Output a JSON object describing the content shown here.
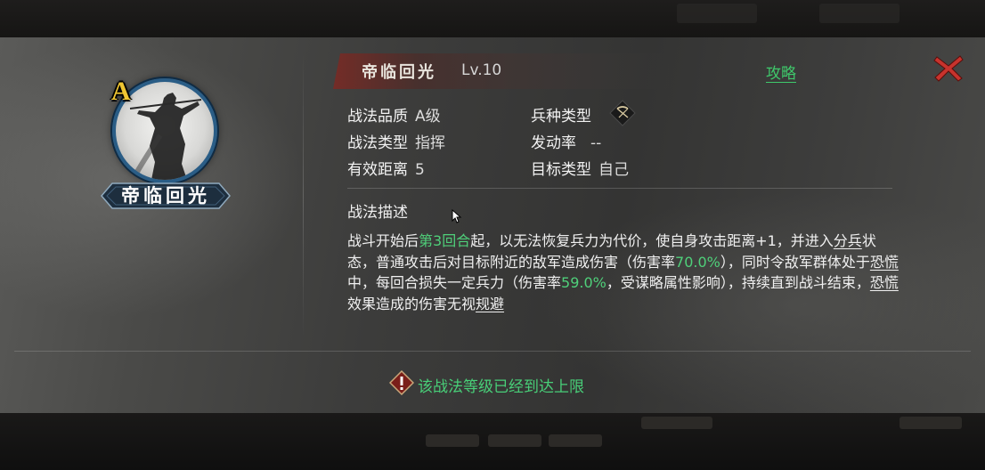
{
  "skill": {
    "name": "帝临回光",
    "level": "Lv.10",
    "grade_badge": "A",
    "plate_name": "帝临回光"
  },
  "header": {
    "guide_label": "攻略"
  },
  "attributes": {
    "quality_label": "战法品质",
    "quality_value": "A级",
    "type_label": "战法类型",
    "type_value": "指挥",
    "range_label": "有效距离",
    "range_value": "5",
    "troop_label": "兵种类型",
    "troop_icon": "bow-icon",
    "rate_label": "发动率",
    "rate_value": "--",
    "target_label": "目标类型",
    "target_value": "自己"
  },
  "description": {
    "title": "战法描述",
    "p1": "战斗开始后",
    "p2": "第3回合",
    "p3": "起，以无法恢复兵力为代价，使自身攻击距离+1，并进入",
    "p4": "分兵",
    "p5": "状态，普通攻击后对目标附近的敌军造成伤害（伤害率",
    "p6": "70.0%",
    "p7": "），同时令敌军群体处于",
    "p8": "恐慌",
    "p9": "中，每回合损失一定兵力（伤害率",
    "p10": "59.0%",
    "p11": "，受谋略属性影响），持续直到战斗结束，",
    "p12": "恐慌",
    "p13": "效果造成的伤害无视",
    "p14": "规避"
  },
  "notice": {
    "text": "该战法等级已经到达上限",
    "icon": "warning-icon"
  },
  "colors": {
    "accent_green": "#3fc96b",
    "grade_gold": "#f0c632",
    "close_red": "#c8332d"
  }
}
